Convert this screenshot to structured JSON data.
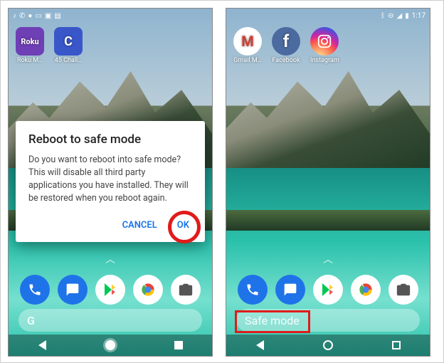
{
  "left": {
    "status_icons": [
      "music",
      "call",
      "voice",
      "wifi",
      "screenshot",
      "square",
      "sms"
    ],
    "apps": [
      {
        "label": "Roku M…",
        "icon_text": "Roku"
      },
      {
        "label": "45 Chall…",
        "icon_text": "C"
      }
    ],
    "dialog": {
      "title": "Reboot to safe mode",
      "body": "Do you want to reboot into safe mode? This will disable all third party applications you have installed. They will be restored when you reboot again.",
      "cancel": "CANCEL",
      "ok": "OK"
    },
    "search_hint": "G",
    "annotation": "OK button circled"
  },
  "right": {
    "status_icons": [
      "bluetooth",
      "dnd",
      "signal",
      "battery"
    ],
    "time": "1:17",
    "apps": [
      {
        "label": "Gmail M…",
        "glyph": "M"
      },
      {
        "label": "Facebook",
        "glyph": "f"
      },
      {
        "label": "Instagram",
        "glyph": "◎"
      }
    ],
    "safe_mode_text": "Safe mode",
    "annotation": "Safe mode badge highlighted"
  },
  "dock": {
    "items": [
      "phone",
      "messages",
      "play-store",
      "chrome",
      "camera"
    ]
  },
  "nav": {
    "buttons": [
      "back",
      "home",
      "recent"
    ]
  }
}
